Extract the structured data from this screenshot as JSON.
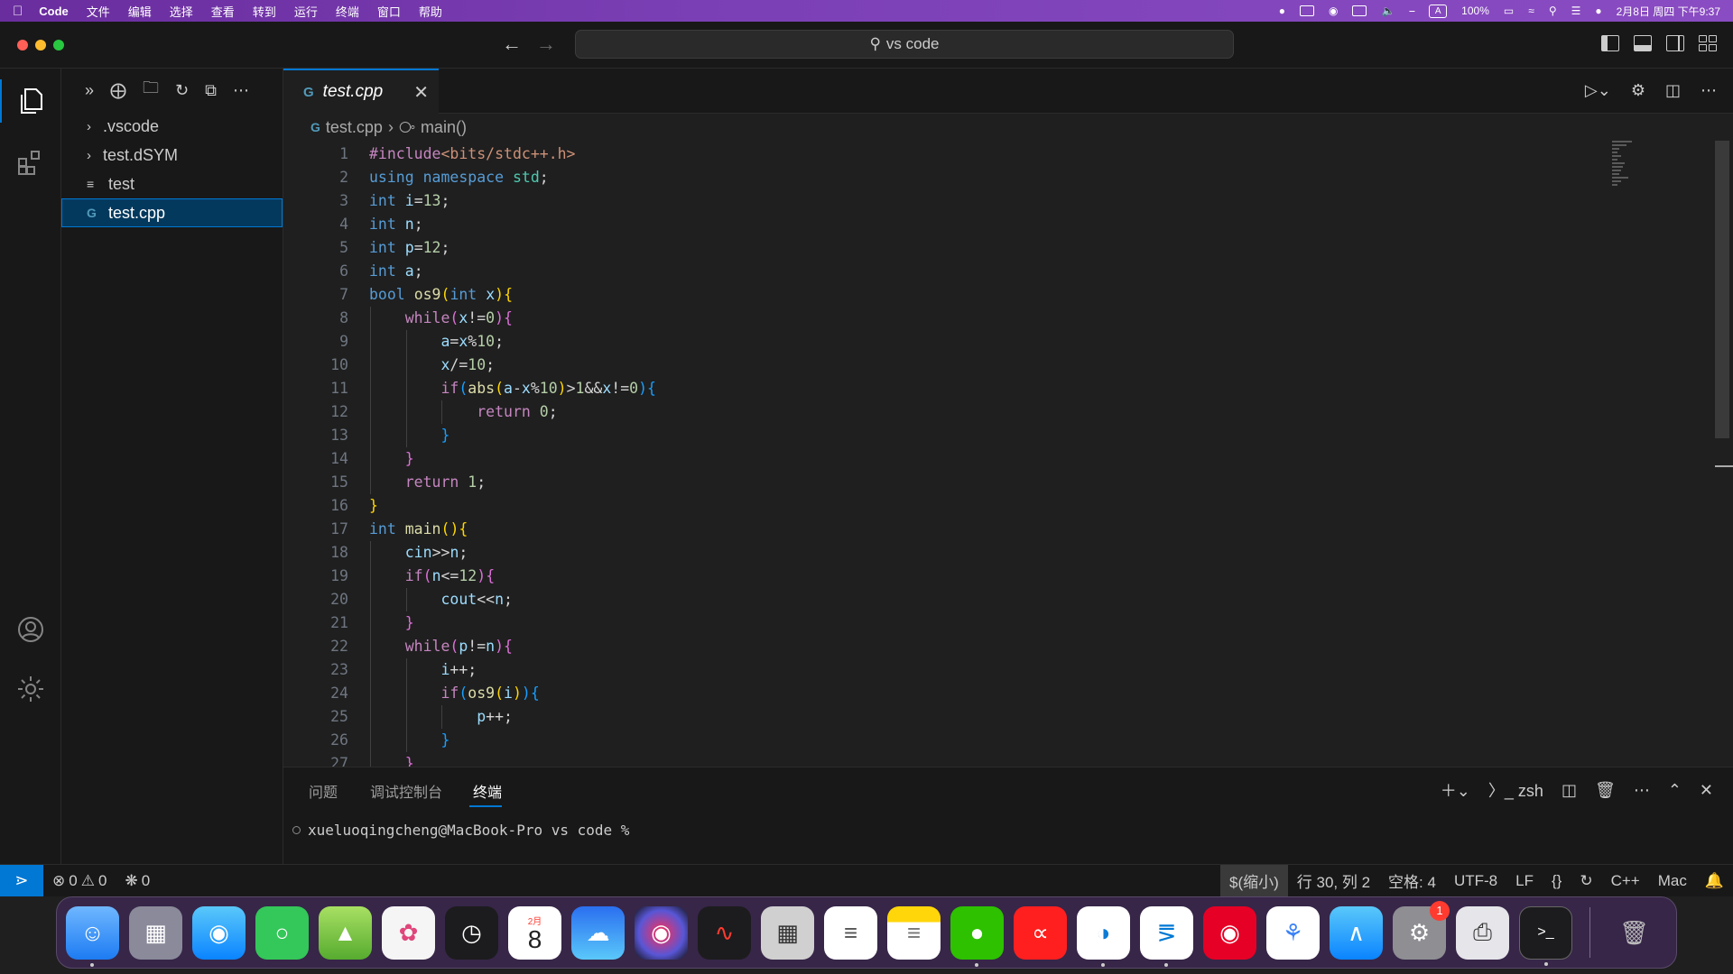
{
  "menubar": {
    "app_name": "Code",
    "items": [
      "文件",
      "编辑",
      "选择",
      "查看",
      "转到",
      "运行",
      "终端",
      "窗口",
      "帮助"
    ],
    "battery": "100%",
    "ime": "A",
    "clock": "2月8日 周四 下午9:37"
  },
  "titlebar": {
    "search_text": "vs code"
  },
  "explorer": {
    "items": [
      {
        "label": ".vscode",
        "kind": "folder"
      },
      {
        "label": "test.dSYM",
        "kind": "folder"
      },
      {
        "label": "test",
        "kind": "file"
      },
      {
        "label": "test.cpp",
        "kind": "cpp",
        "selected": true
      }
    ]
  },
  "tab": {
    "label": "test.cpp"
  },
  "breadcrumb": {
    "file": "test.cpp",
    "symbol": "main()"
  },
  "code_lines": [
    "#include<bits/stdc++.h>",
    "using namespace std;",
    "int i=13;",
    "int n;",
    "int p=12;",
    "int a;",
    "bool os9(int x){",
    "    while(x!=0){",
    "        a=x%10;",
    "        x/=10;",
    "        if(abs(a-x%10)>1&&x!=0){",
    "            return 0;",
    "        }",
    "    }",
    "    return 1;",
    "}",
    "int main(){",
    "    cin>>n;",
    "    if(n<=12){",
    "        cout<<n;",
    "    }",
    "    while(p!=n){",
    "        i++;",
    "        if(os9(i)){",
    "            p++;",
    "        }",
    "    }"
  ],
  "panel": {
    "tabs": [
      "问题",
      "调试控制台",
      "终端"
    ],
    "active_tab": "终端",
    "shell": "zsh",
    "prompt": "xueluoqingcheng@MacBook-Pro vs code %"
  },
  "statusbar": {
    "errors": "0",
    "warnings": "0",
    "ports": "0",
    "zoom": "$(缩小)",
    "position": "行 30, 列 2",
    "spaces": "空格: 4",
    "encoding": "UTF-8",
    "eol": "LF",
    "language": "C++",
    "platform": "Mac"
  },
  "dock": {
    "calendar_month": "2月",
    "calendar_day": "8",
    "settings_badge": "1"
  },
  "colors": {
    "accent": "#0078d4",
    "editor_bg": "#1f1f1f",
    "chrome_bg": "#181818"
  }
}
